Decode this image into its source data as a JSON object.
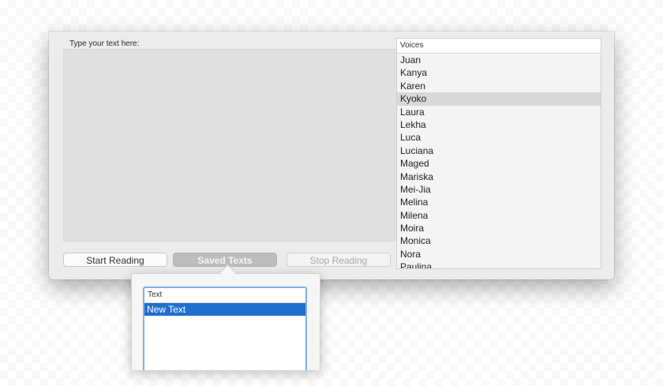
{
  "input": {
    "prompt_label": "Type your text here:",
    "text_value": ""
  },
  "buttons": {
    "start_label": "Start Reading",
    "saved_label": "Saved Texts",
    "stop_label": "Stop Reading"
  },
  "voices": {
    "header": "Voices",
    "selected": "Kyoko",
    "items": [
      "Juan",
      "Kanya",
      "Karen",
      "Kyoko",
      "Laura",
      "Lekha",
      "Luca",
      "Luciana",
      "Maged",
      "Mariska",
      "Mei-Jia",
      "Melina",
      "Milena",
      "Moira",
      "Monica",
      "Nora",
      "Paulina"
    ]
  },
  "saved_texts": {
    "header": "Text",
    "items": [
      "New Text"
    ],
    "selected": "New Text"
  },
  "colors": {
    "selection_blue": "#1f6fd0",
    "focus_ring": "#7fb0e6",
    "selected_gray": "#d8d8d8"
  }
}
